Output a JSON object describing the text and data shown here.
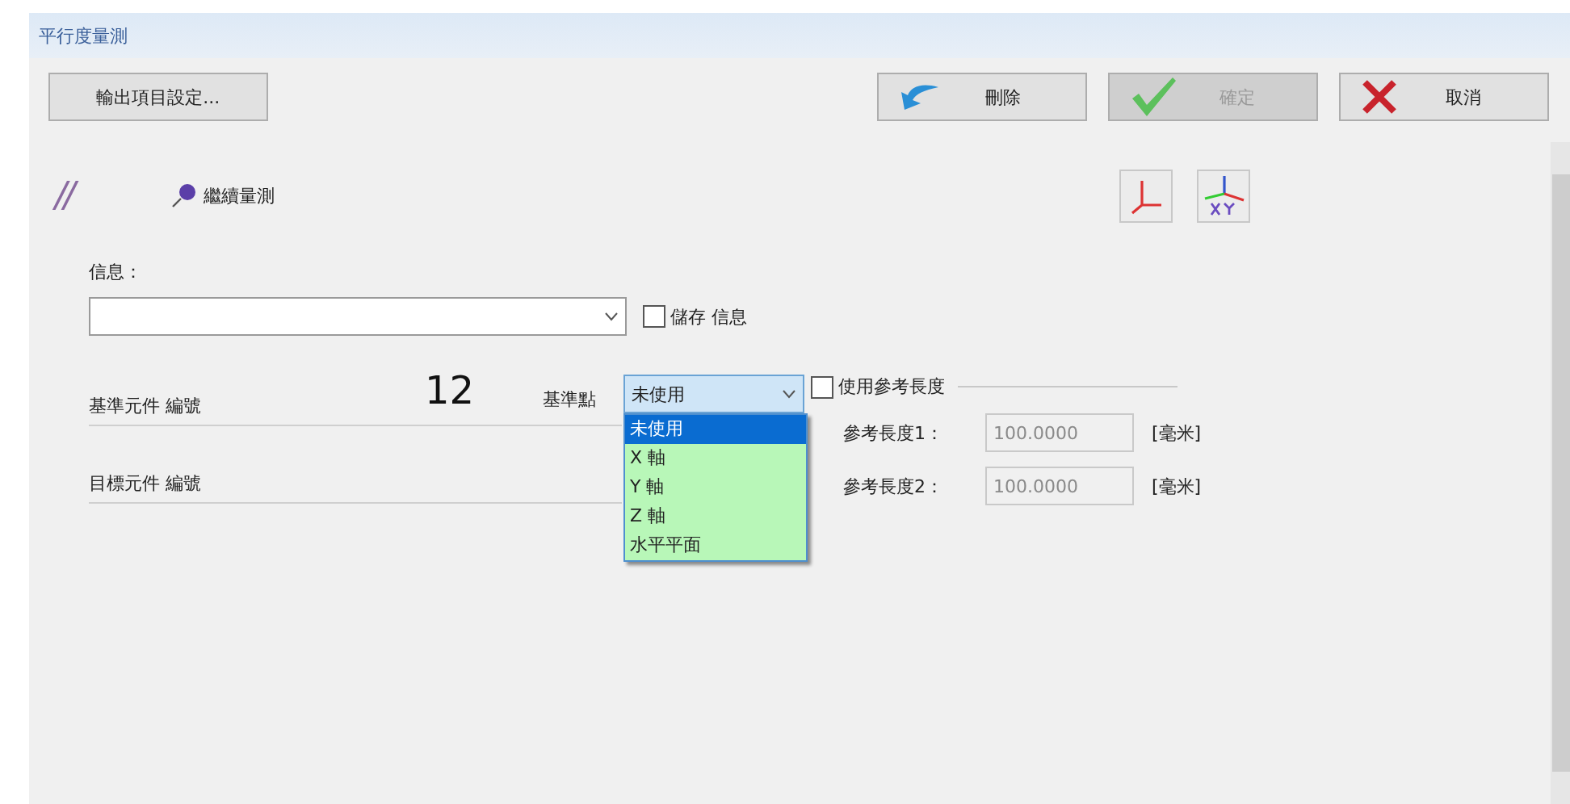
{
  "window": {
    "title": "平行度量測"
  },
  "toolbar": {
    "output_settings": "輸出項目設定...",
    "buttons": [
      {
        "kind": "delete",
        "label": "刪除",
        "disabled": false
      },
      {
        "kind": "confirm",
        "label": "確定",
        "disabled": true
      },
      {
        "kind": "cancel",
        "label": "取消",
        "disabled": false
      }
    ]
  },
  "symbol": "//",
  "continue_measure": "繼續量測",
  "info": {
    "label": "信息：",
    "save_checkbox": {
      "label": "儲存 信息",
      "checked": false
    }
  },
  "base_element": {
    "label": "基準元件 編號",
    "number": "12",
    "point_label": "基準點",
    "point_value": "未使用",
    "dropdown_open": true,
    "options": [
      {
        "label": "未使用",
        "selected": true
      },
      {
        "label": "X 軸",
        "selected": false
      },
      {
        "label": "Y 軸",
        "selected": false
      },
      {
        "label": "Z 軸",
        "selected": false
      },
      {
        "label": "水平平面",
        "selected": false
      }
    ]
  },
  "target_element": {
    "label": "目標元件 編號"
  },
  "reference": {
    "checkbox": {
      "label": "使用參考長度",
      "checked": false
    },
    "rows": [
      {
        "label": "參考長度1：",
        "value": "100.0000",
        "unit": "[毫米]",
        "disabled": true
      },
      {
        "label": "參考長度2：",
        "value": "100.0000",
        "unit": "[毫米]",
        "disabled": true
      }
    ]
  }
}
